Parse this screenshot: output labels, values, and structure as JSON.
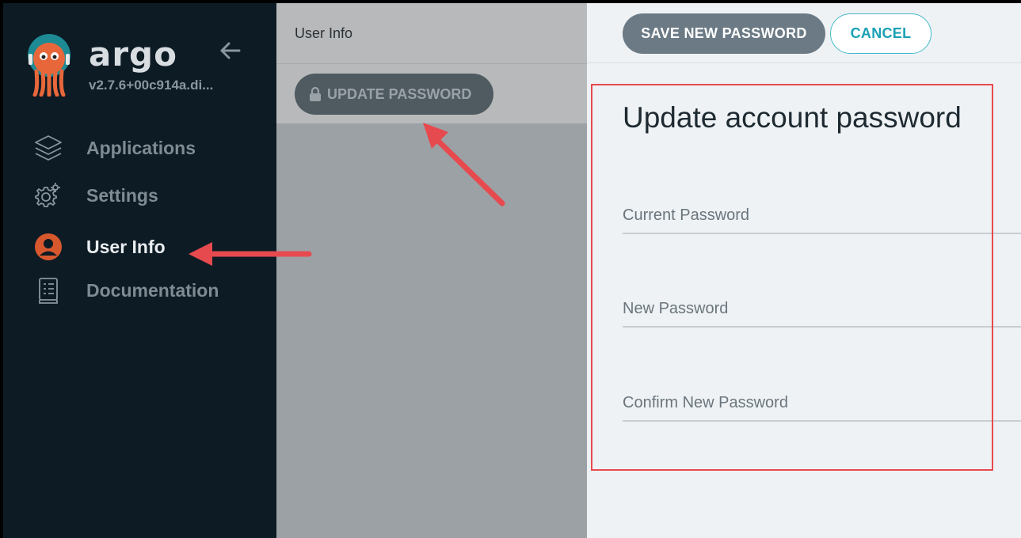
{
  "sidebar": {
    "brand": "argo",
    "version": "v2.7.6+00c914a.di...",
    "items": [
      {
        "label": "Applications",
        "icon": "layers-icon",
        "active": false
      },
      {
        "label": "Settings",
        "icon": "gear-icon",
        "active": false
      },
      {
        "label": "User Info",
        "icon": "user-icon",
        "active": true
      },
      {
        "label": "Documentation",
        "icon": "document-icon",
        "active": false
      }
    ]
  },
  "middle": {
    "title": "User Info",
    "update_password_label": "UPDATE PASSWORD"
  },
  "toolbar": {
    "save_label": "SAVE NEW PASSWORD",
    "cancel_label": "CANCEL"
  },
  "form": {
    "title": "Update account password",
    "current_password_placeholder": "Current Password",
    "new_password_placeholder": "New Password",
    "confirm_password_placeholder": "Confirm New Password"
  },
  "colors": {
    "sidebar_bg": "#0d1b24",
    "accent_teal": "#1aa1b4",
    "annotation_red": "#e64a4f",
    "user_icon": "#d8582e"
  }
}
